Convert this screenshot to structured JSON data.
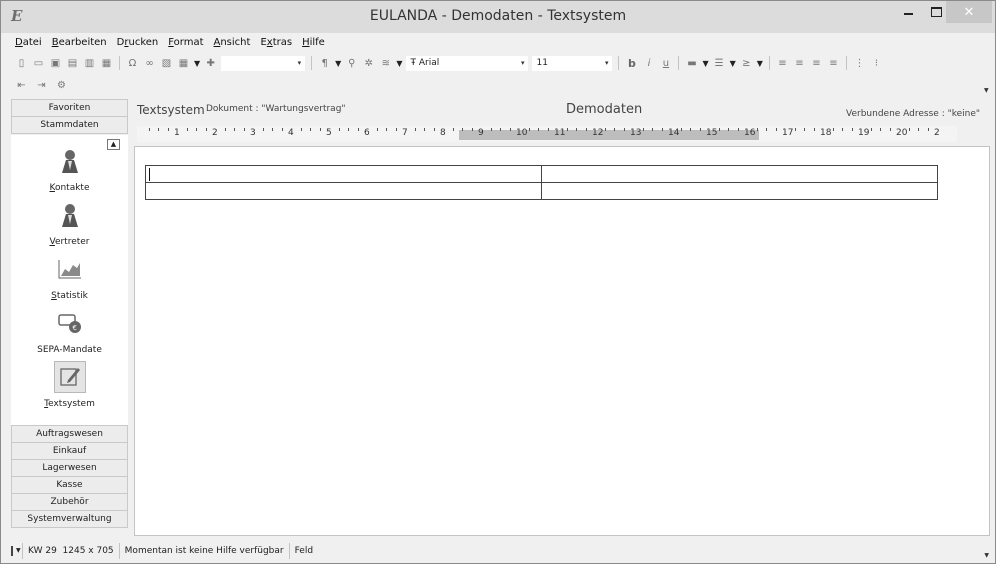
{
  "window": {
    "title": "EULANDA - Demodaten - Textsystem",
    "logo_text": "E",
    "logo_superscript": "",
    "close_glyph": "✕"
  },
  "menu": {
    "items": [
      {
        "pre": "",
        "key": "D",
        "post": "atei"
      },
      {
        "pre": "",
        "key": "B",
        "post": "earbeiten"
      },
      {
        "pre": "D",
        "key": "r",
        "post": "ucken"
      },
      {
        "pre": "",
        "key": "F",
        "post": "ormat"
      },
      {
        "pre": "",
        "key": "A",
        "post": "nsicht"
      },
      {
        "pre": "E",
        "key": "x",
        "post": "tras"
      },
      {
        "pre": "",
        "key": "H",
        "post": "ilfe"
      }
    ]
  },
  "toolbar": {
    "font_name": "Arial",
    "font_size": "11",
    "font_glyph": "Ŧ",
    "style_combo": "",
    "bold": "b",
    "italic": "i",
    "underline": "u"
  },
  "nav": {
    "top_headers": [
      "Favoriten",
      "Stammdaten"
    ],
    "items": [
      {
        "label": "Kontakte",
        "key": "K",
        "icon": "contact-icon"
      },
      {
        "label": "Vertreter",
        "key": "V",
        "icon": "representative-icon"
      },
      {
        "label": "Statistik",
        "key": "S",
        "icon": "statistics-icon"
      },
      {
        "label": "SEPA-Mandate",
        "key": "",
        "icon": "sepa-mandate-icon"
      },
      {
        "label": "Textsystem",
        "key": "T",
        "icon": "textsystem-icon"
      }
    ],
    "bottom_headers": [
      "Auftragswesen",
      "Einkauf",
      "Lagerwesen",
      "Kasse",
      "Zubehör",
      "Systemverwaltung"
    ]
  },
  "document": {
    "title": "Textsystem",
    "name": "Dokument : \"Wartungsvertrag\"",
    "center": "Demodaten",
    "address": "Verbundene Adresse : \"keine\""
  },
  "ruler": {
    "labels": [
      "1",
      "2",
      "3",
      "4",
      "5",
      "6",
      "7",
      "8",
      "9",
      "10",
      "11",
      "12",
      "13",
      "14",
      "15",
      "16",
      "17",
      "18",
      "19",
      "20",
      "2"
    ]
  },
  "status": {
    "week": "KW 29",
    "resolution": "1245 x 705",
    "help": "Momentan ist keine Hilfe verfügbar",
    "field": "Feld"
  }
}
